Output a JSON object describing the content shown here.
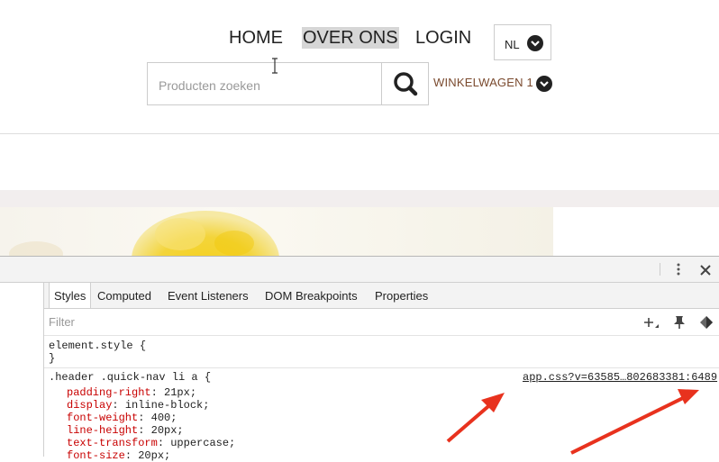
{
  "site": {
    "nav": [
      "HOME",
      "OVER ONS",
      "LOGIN"
    ],
    "language": "NL",
    "search": {
      "placeholder": "Producten zoeken"
    },
    "cart_label": "WINKELWAGEN 1"
  },
  "devtools": {
    "tabs": [
      "Styles",
      "Computed",
      "Event Listeners",
      "DOM Breakpoints",
      "Properties"
    ],
    "active_tab": "Styles",
    "filter_placeholder": "Filter",
    "element_style": {
      "selector": "element.style {",
      "close": "}"
    },
    "rule": {
      "selector": ".header .quick-nav li a {",
      "source": "app.css?v=63585…802683381:6489",
      "declarations": [
        {
          "property": "padding-right",
          "value": "21px;"
        },
        {
          "property": "display",
          "value": "inline-block;"
        },
        {
          "property": "font-weight",
          "value": "400;"
        },
        {
          "property": "line-height",
          "value": "20px;"
        },
        {
          "property": "text-transform",
          "value": "uppercase;"
        },
        {
          "property": "font-size",
          "value": "20px;"
        }
      ]
    }
  },
  "colors": {
    "cart_text": "#7a4a2e",
    "nav_highlight": "#d6d6d6",
    "css_property": "#c80000",
    "annotation_arrow": "#e8321e"
  }
}
